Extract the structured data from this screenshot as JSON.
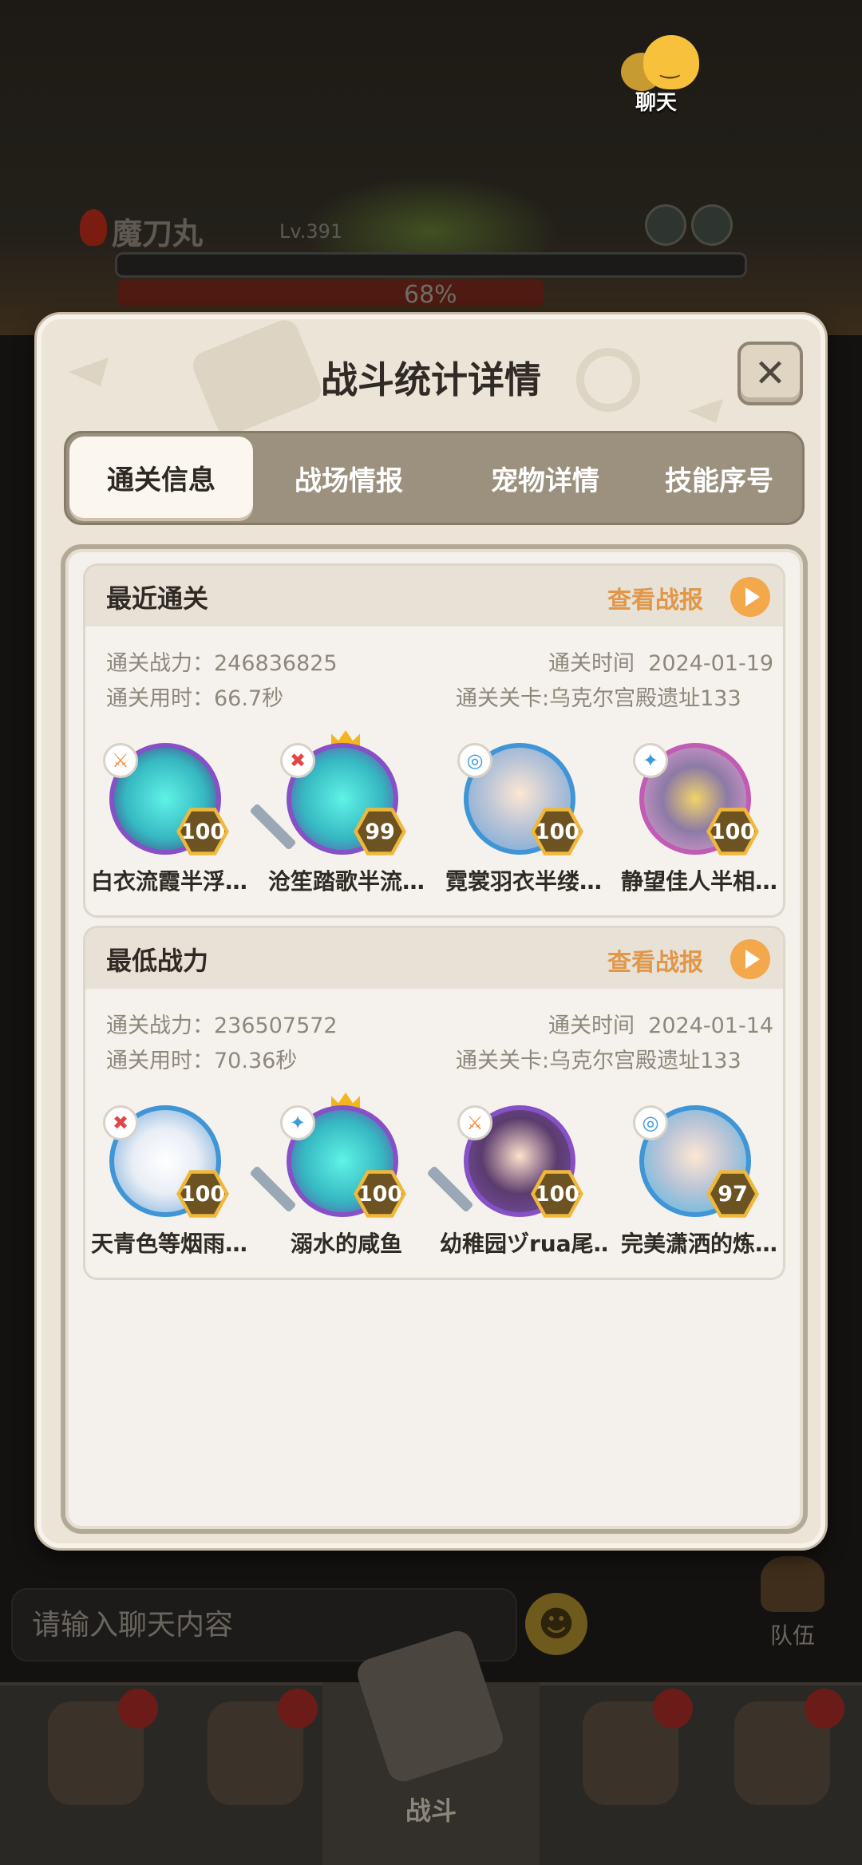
{
  "background": {
    "chat_button_label": "聊天",
    "boss": {
      "name": "魔刀丸",
      "level": "Lv.391",
      "progress_text": "68%",
      "progress": 0.68
    },
    "chat_input_placeholder": "请输入聊天内容",
    "team_label": "队伍",
    "nav": {
      "battle_label": "战斗"
    }
  },
  "modal": {
    "title": "战斗统计详情",
    "close_icon": "close-icon",
    "tabs": [
      {
        "label": "通关信息",
        "active": true
      },
      {
        "label": "战场情报",
        "active": false
      },
      {
        "label": "宠物详情",
        "active": false
      },
      {
        "label": "技能序号",
        "active": false
      }
    ],
    "cards": [
      {
        "title": "最近通关",
        "link": "查看战报",
        "power_label": "通关战力：",
        "power": "246836825",
        "time_label": "通关时间",
        "time": "2024-01-19",
        "duration_label": "通关用时：",
        "duration": "66.7秒",
        "stage_label": "通关关卡:",
        "stage": "乌克尔宫殿遗址133",
        "pets": [
          {
            "name": "白衣流霞半浮…",
            "level": "100"
          },
          {
            "name": "沧笙踏歌半流…",
            "level": "99"
          },
          {
            "name": "霓裳羽衣半缕…",
            "level": "100"
          },
          {
            "name": "静望佳人半相…",
            "level": "100"
          }
        ]
      },
      {
        "title": "最低战力",
        "link": "查看战报",
        "power_label": "通关战力：",
        "power": "236507572",
        "time_label": "通关时间",
        "time": "2024-01-14",
        "duration_label": "通关用时：",
        "duration": "70.36秒",
        "stage_label": "通关关卡:",
        "stage": "乌克尔宫殿遗址133",
        "pets": [
          {
            "name": "天青色等烟雨…",
            "level": "100"
          },
          {
            "name": "溺水的咸鱼",
            "level": "100"
          },
          {
            "name": "幼稚园ヅrua尾…",
            "level": "100"
          },
          {
            "name": "完美潇洒的炼…",
            "level": "97"
          }
        ]
      }
    ]
  },
  "colors": {
    "accent_orange": "#f3a84c",
    "level_gold": "#f0b83a",
    "panel": "#ebe4d7"
  }
}
